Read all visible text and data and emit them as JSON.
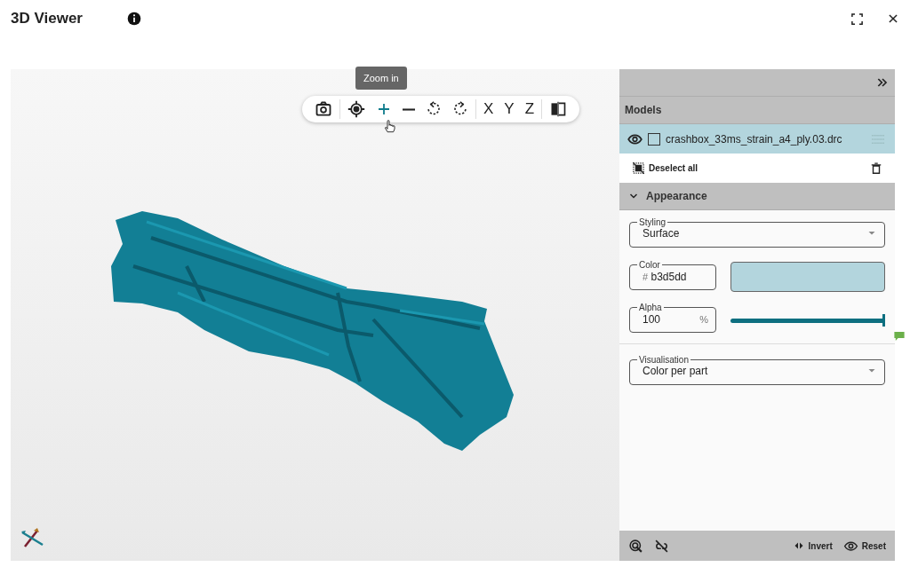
{
  "window": {
    "title": "3D Viewer"
  },
  "toolbar": {
    "tooltip": "Zoom in",
    "buttons": [
      {
        "kind": "camera",
        "selected": false
      },
      {
        "kind": "target",
        "selected": false
      },
      {
        "kind": "zoomin",
        "selected": true
      },
      {
        "kind": "zoomout",
        "selected": false
      },
      {
        "kind": "rotleft",
        "selected": false
      },
      {
        "kind": "rotright",
        "selected": false
      },
      {
        "kind": "axis",
        "label": "X",
        "selected": false
      },
      {
        "kind": "axis",
        "label": "Y",
        "selected": false
      },
      {
        "kind": "axis",
        "label": "Z",
        "selected": false
      },
      {
        "kind": "split",
        "selected": false
      }
    ]
  },
  "panel": {
    "models_title": "Models",
    "models": [
      {
        "name": "crashbox_33ms_strain_a4_ply.03.drc",
        "selected": true,
        "checked": false
      }
    ],
    "deselect_all": "Deselect all",
    "appearance": {
      "title": "Appearance",
      "expanded": true,
      "styling": {
        "label": "Styling",
        "value": "Surface"
      },
      "color": {
        "label": "Color",
        "prefix": "#",
        "value": "b3d5dd"
      },
      "alpha": {
        "label": "Alpha",
        "value": "100",
        "unit": "%",
        "level": 1
      },
      "visualisation": {
        "label": "Visualisation",
        "value": "Color per part"
      }
    },
    "footer": {
      "invert": "Invert",
      "reset": "Reset"
    }
  }
}
